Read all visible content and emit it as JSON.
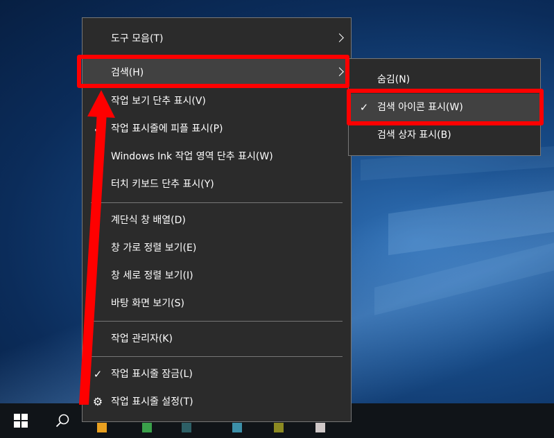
{
  "context_menu": {
    "items": [
      {
        "label": "도구 모음(T)"
      },
      {
        "label": "검색(H)"
      },
      {
        "label": "작업 보기 단추 표시(V)"
      },
      {
        "label": "작업 표시줄에 피플 표시(P)"
      },
      {
        "label": "Windows Ink 작업 영역 단추 표시(W)"
      },
      {
        "label": "터치 키보드 단추 표시(Y)"
      },
      {
        "label": "계단식 창 배열(D)"
      },
      {
        "label": "창 가로 정렬 보기(E)"
      },
      {
        "label": "창 세로 정렬 보기(I)"
      },
      {
        "label": "바탕 화면 보기(S)"
      },
      {
        "label": "작업 관리자(K)"
      },
      {
        "label": "작업 표시줄 잠금(L)"
      },
      {
        "label": "작업 표시줄 설정(T)"
      }
    ],
    "check_glyph": "✓",
    "gear_glyph": "⚙"
  },
  "search_submenu": {
    "items": [
      {
        "label": "숨김(N)"
      },
      {
        "label": "검색 아이콘 표시(W)"
      },
      {
        "label": "검색 상자 표시(B)"
      }
    ]
  },
  "colors": {
    "menu_bg": "#2b2b2b",
    "highlight_bg": "#414141",
    "annotation_red": "#ff0000",
    "text": "#ffffff"
  }
}
